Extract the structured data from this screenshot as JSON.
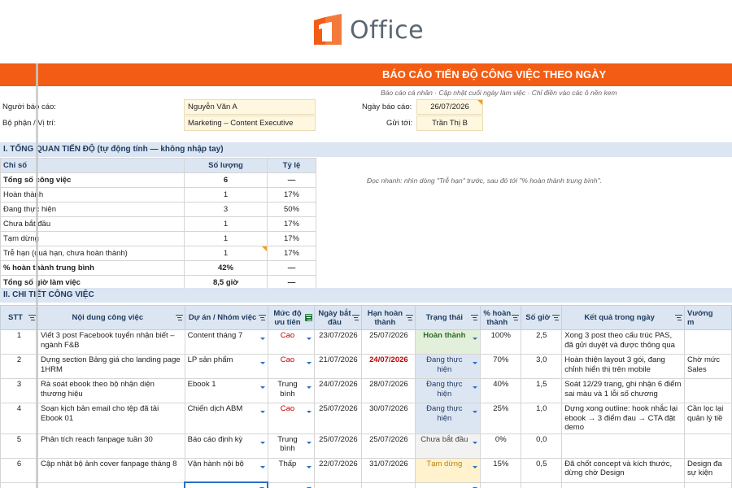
{
  "logo": {
    "text": "Office",
    "mark": "1office-logo-icon",
    "color": "#f25c14"
  },
  "banner": {
    "title": "BÁO CÁO TIẾN ĐỘ CÔNG VIỆC THEO NGÀY",
    "color": "#f25c14"
  },
  "subnote": "Báo cáo cá nhân · Cập nhật cuối ngày làm việc · Chỉ điền vào các ô nền kem",
  "info": {
    "reporter_label": "Người báo cáo:",
    "reporter_value": "Nguyễn Văn A",
    "dept_label": "Bộ phận / Vị trí:",
    "dept_value": "Marketing – Content Executive",
    "date_label": "Ngày báo cáo:",
    "date_value": "26/07/2026",
    "sendto_label": "Gửi tới:",
    "sendto_value": "Trần Thị B"
  },
  "section1": {
    "title": "I. TỔNG QUAN TIẾN ĐỘ  (tự động tính — không nhập tay)",
    "headers": [
      "Chỉ số",
      "Số lượng",
      "Tỷ lệ"
    ],
    "rows": [
      {
        "label": "Tổng số công việc",
        "qty": "6",
        "rate": "—",
        "bold": true
      },
      {
        "label": "Hoàn thành",
        "qty": "1",
        "rate": "17%"
      },
      {
        "label": "Đang thực hiện",
        "qty": "3",
        "rate": "50%"
      },
      {
        "label": "Chưa bắt đầu",
        "qty": "1",
        "rate": "17%"
      },
      {
        "label": "Tạm dừng",
        "qty": "1",
        "rate": "17%"
      },
      {
        "label": "Trễ hạn (quá hạn, chưa hoàn thành)",
        "qty": "1",
        "rate": "17%"
      },
      {
        "label": "% hoàn thành trung bình",
        "qty": "42%",
        "rate": "—",
        "bold": true
      },
      {
        "label": "Tổng số giờ làm việc",
        "qty": "8,5 giờ",
        "rate": "—",
        "bold": true
      }
    ],
    "quick_note": "Đọc nhanh: nhìn dòng \"Trễ hạn\" trước, sau đó tới \"% hoàn thành trung bình\"."
  },
  "section2": {
    "title": "II. CHI TIẾT CÔNG VIỆC",
    "headers": [
      "STT",
      "Nội dung công việc",
      "Dự án / Nhóm việc",
      "Mức độ ưu tiên",
      "Ngày bắt đầu",
      "Hạn hoàn thành",
      "Trạng thái",
      "% hoàn thành",
      "Số giờ",
      "Kết quả trong ngày",
      "Vướng m"
    ],
    "rows": [
      {
        "stt": "1",
        "task": "Viết 3 post Facebook tuyển nhận biết – ngành F&B",
        "project": "Content tháng 7",
        "priority": "Cao",
        "start": "23/07/2026",
        "due": "25/07/2026",
        "status": "Hoàn thành",
        "status_class": "st-done",
        "pct": "100%",
        "hours": "2,5",
        "result": "Xong 3 post theo cấu trúc PAS, đã gửi duyệt và được thông qua",
        "issue": ""
      },
      {
        "stt": "2",
        "task": "Dựng section Bảng giá cho landing page 1HRM",
        "project": "LP sản phẩm",
        "priority": "Cao",
        "start": "21/07/2026",
        "due": "24/07/2026",
        "due_late": true,
        "status": "Đang thực hiện",
        "status_class": "st-prog",
        "pct": "70%",
        "hours": "3,0",
        "result": "Hoàn thiện layout 3 gói, đang chỉnh hiển thị trên mobile",
        "issue": "Chờ mức Sales"
      },
      {
        "stt": "3",
        "task": "Rà soát ebook theo bộ nhận diện thương hiệu",
        "project": "Ebook 1",
        "priority": "Trung bình",
        "start": "24/07/2026",
        "due": "28/07/2026",
        "status": "Đang thực hiện",
        "status_class": "st-prog",
        "pct": "40%",
        "hours": "1,5",
        "result": "Soát 12/29 trang, ghi nhận 6 điểm sai màu và 1 lỗi số chương",
        "issue": ""
      },
      {
        "stt": "4",
        "task": "Soạn kịch bản email cho tệp đã tải Ebook 01",
        "project": "Chiến dịch ABM",
        "priority": "Cao",
        "start": "25/07/2026",
        "due": "30/07/2026",
        "status": "Đang thực hiện",
        "status_class": "st-prog",
        "pct": "25%",
        "hours": "1,0",
        "result": "Dựng xong outline: hook nhắc lại ebook → 3 điểm đau → CTA đặt demo",
        "issue": "Cần lọc lại quản lý tiề"
      },
      {
        "stt": "5",
        "task": "Phân tích reach fanpage tuần 30",
        "project": "Báo cáo định kỳ",
        "priority": "Trung bình",
        "start": "25/07/2026",
        "due": "25/07/2026",
        "status": "Chưa bắt đầu",
        "status_class": "st-none",
        "pct": "0%",
        "hours": "0,0",
        "result": "",
        "issue": ""
      },
      {
        "stt": "6",
        "task": "Cập nhật bộ ảnh cover fanpage tháng 8",
        "project": "Vận hành nội bộ",
        "priority": "Thấp",
        "start": "22/07/2026",
        "due": "31/07/2026",
        "status": "Tạm dừng",
        "status_class": "st-pause",
        "pct": "15%",
        "hours": "0,5",
        "result": "Đã chốt concept và kích thước, dừng chờ Design",
        "issue": "Design đa sự kiện"
      }
    ]
  }
}
